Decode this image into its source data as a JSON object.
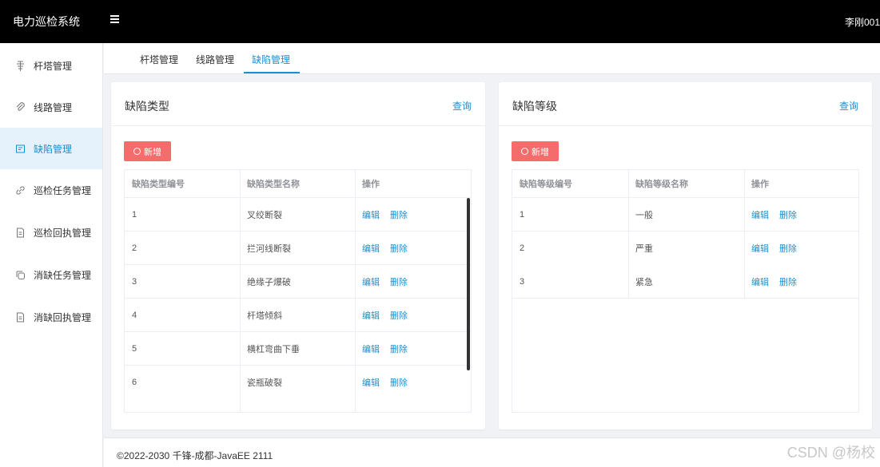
{
  "app": {
    "title": "电力巡检系统",
    "user": "李刚001"
  },
  "sidebar": {
    "items": [
      {
        "label": "杆塔管理",
        "icon": "tower-icon",
        "active": false
      },
      {
        "label": "线路管理",
        "icon": "paperclip-icon",
        "active": false
      },
      {
        "label": "缺陷管理",
        "icon": "document-icon",
        "active": true
      },
      {
        "label": "巡检任务管理",
        "icon": "link-icon",
        "active": false
      },
      {
        "label": "巡检回执管理",
        "icon": "file-icon",
        "active": false
      },
      {
        "label": "消缺任务管理",
        "icon": "copy-icon",
        "active": false
      },
      {
        "label": "消缺回执管理",
        "icon": "file-icon",
        "active": false
      }
    ]
  },
  "tabs": [
    {
      "label": "杆塔管理",
      "active": false
    },
    {
      "label": "线路管理",
      "active": false
    },
    {
      "label": "缺陷管理",
      "active": true
    }
  ],
  "defect_type_panel": {
    "title": "缺陷类型",
    "query_label": "查询",
    "add_label": "新增",
    "columns": [
      "缺陷类型编号",
      "缺陷类型名称",
      "操作"
    ],
    "rows": [
      {
        "id": "1",
        "name": "叉绞断裂"
      },
      {
        "id": "2",
        "name": "拦河线断裂"
      },
      {
        "id": "3",
        "name": "绝缘子爆破"
      },
      {
        "id": "4",
        "name": "杆塔倾斜"
      },
      {
        "id": "5",
        "name": "横杠弯曲下垂"
      },
      {
        "id": "6",
        "name": "瓷瓶破裂"
      }
    ],
    "edit_label": "编辑",
    "delete_label": "删除"
  },
  "defect_level_panel": {
    "title": "缺陷等级",
    "query_label": "查询",
    "add_label": "新增",
    "columns": [
      "缺陷等级编号",
      "缺陷等级名称",
      "操作"
    ],
    "rows": [
      {
        "id": "1",
        "name": "一般"
      },
      {
        "id": "2",
        "name": "严重"
      },
      {
        "id": "3",
        "name": "紧急"
      }
    ],
    "edit_label": "编辑",
    "delete_label": "删除"
  },
  "footer": {
    "text": "©2022-2030 千锋-成都-JavaEE 2111"
  },
  "watermark": "CSDN @杨校",
  "colors": {
    "accent": "#1890d0",
    "danger": "#f56c6c",
    "topbar": "#000000"
  }
}
